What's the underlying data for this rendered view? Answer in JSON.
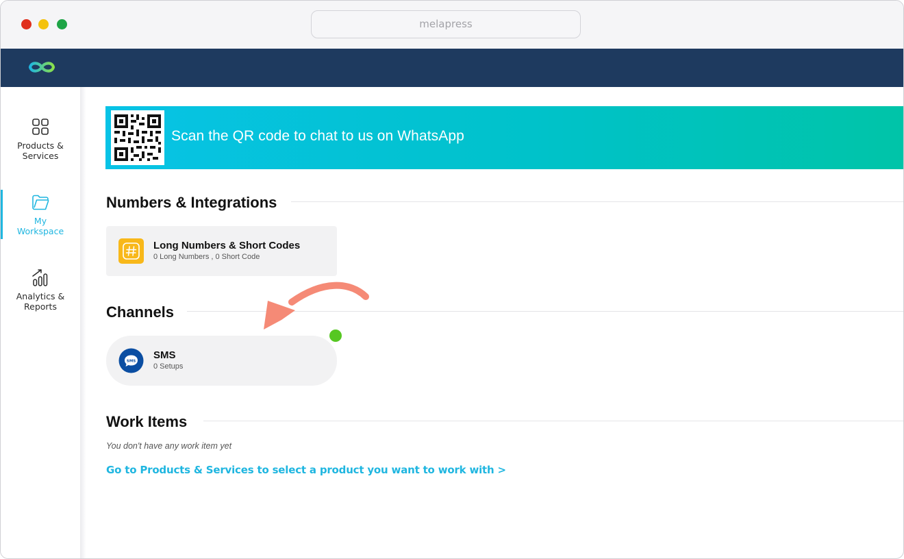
{
  "browser": {
    "url": "melapress"
  },
  "sidebar": {
    "items": [
      {
        "label_line1": "Products &",
        "label_line2": "Services",
        "icon": "grid-icon",
        "active": false
      },
      {
        "label_line1": "My",
        "label_line2": "Workspace",
        "icon": "folder-icon",
        "active": true
      },
      {
        "label_line1": "Analytics &",
        "label_line2": "Reports",
        "icon": "bar-chart-icon",
        "active": false
      }
    ]
  },
  "banner": {
    "text": "Scan the QR code to chat to us on WhatsApp",
    "icon": "qr-code-icon"
  },
  "sections": {
    "numbers": {
      "title": "Numbers & Integrations",
      "card": {
        "title": "Long Numbers & Short Codes",
        "subtitle": "0 Long Numbers ,  0 Short Code",
        "icon": "hash-icon"
      }
    },
    "channels": {
      "title": "Channels",
      "card": {
        "title": "SMS",
        "subtitle": "0 Setups",
        "icon": "sms-chat-icon"
      }
    },
    "work_items": {
      "title": "Work Items",
      "empty_text": "You don't have any work item yet",
      "link": "Go to Products & Services to select a product you want to work with >"
    }
  },
  "colors": {
    "navy": "#1e3a5f",
    "accent": "#1fb6e0",
    "status_green": "#56c722",
    "arrow": "#f58a76",
    "hash_badge": "#f8b81a",
    "sms_badge": "#0b4ea2"
  }
}
